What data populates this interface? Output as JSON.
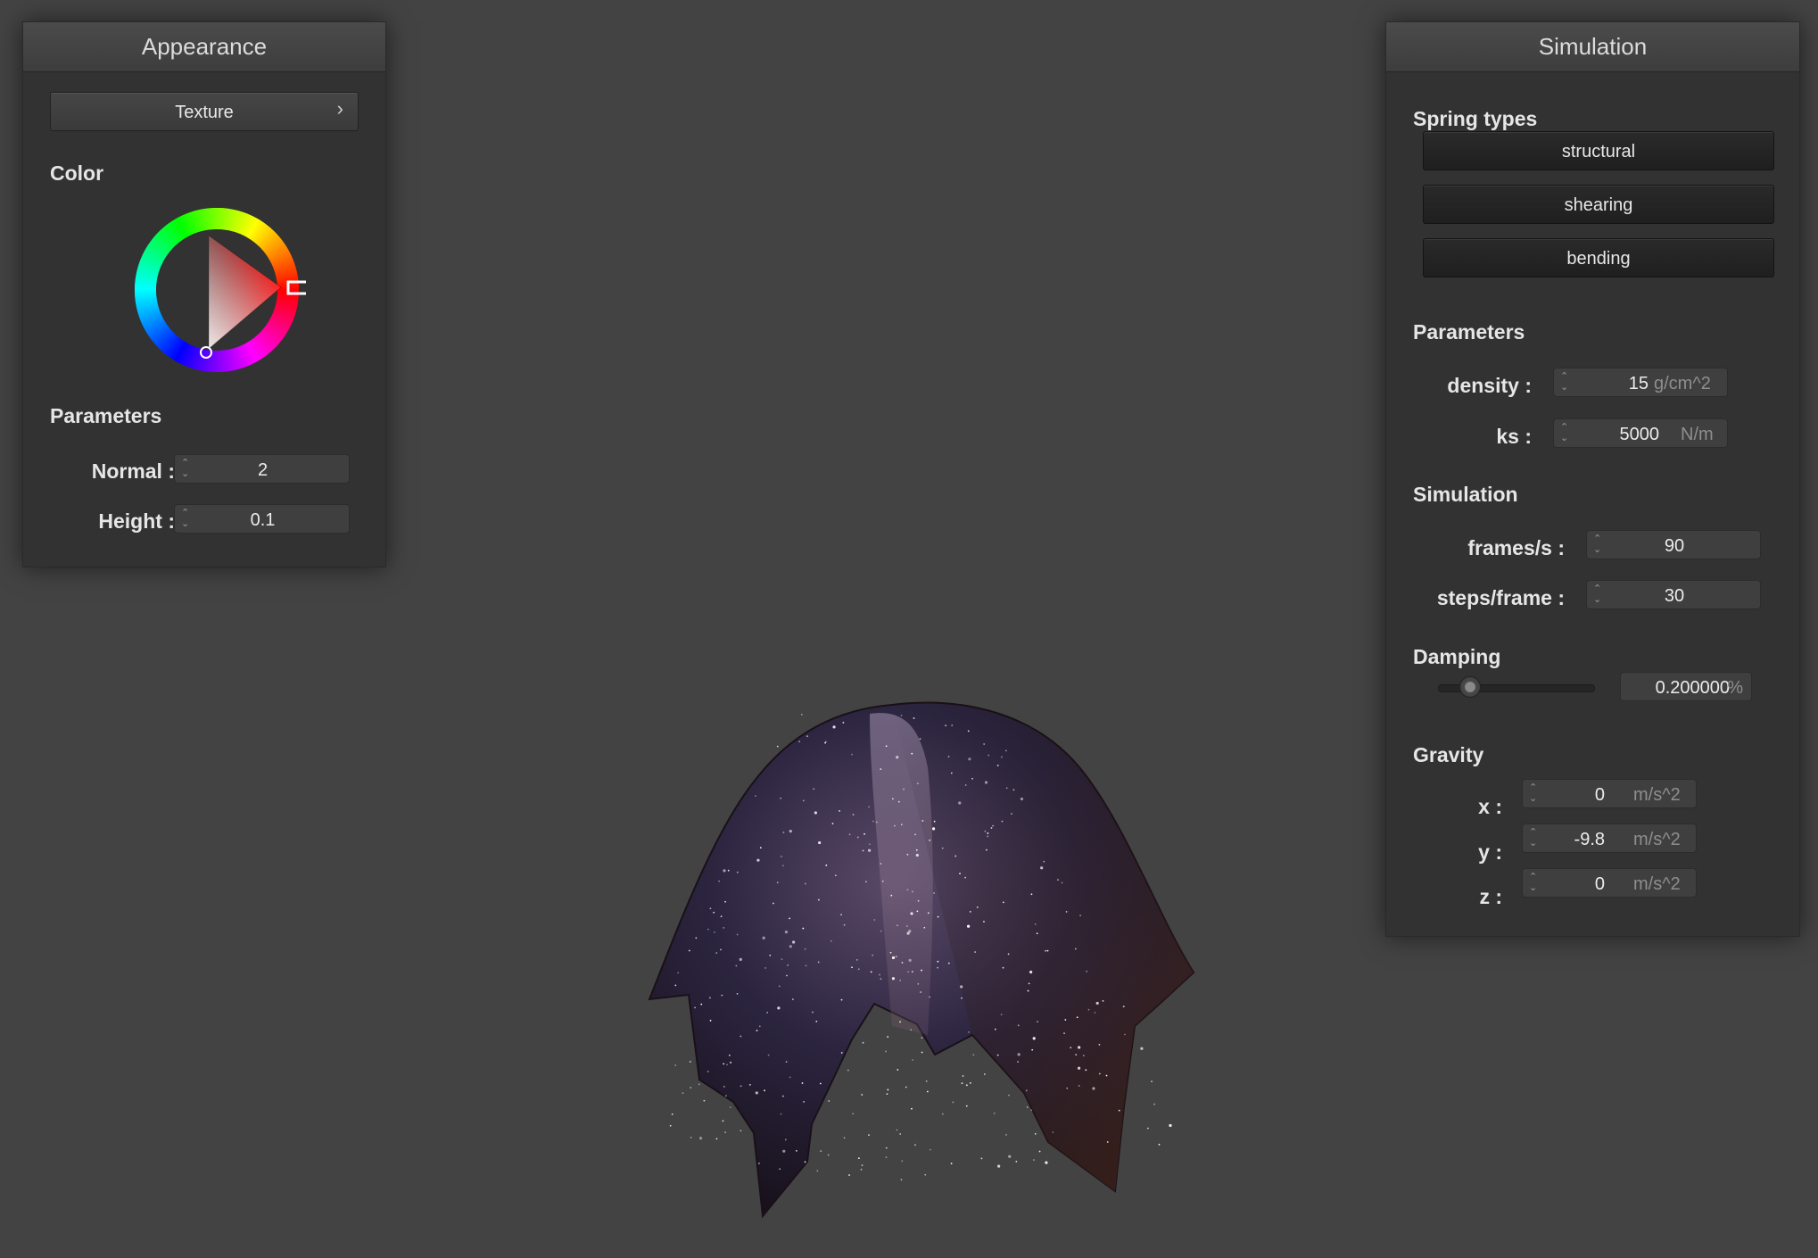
{
  "appearance": {
    "title": "Appearance",
    "texture_button": "Texture",
    "texture_chevron": "›",
    "color_label": "Color",
    "color_value": "#ff0000",
    "parameters_label": "Parameters",
    "normal": {
      "label": "Normal :",
      "value": "2"
    },
    "height": {
      "label": "Height :",
      "value": "0.1"
    }
  },
  "simulation": {
    "title": "Simulation",
    "spring_types_label": "Spring types",
    "spring_types": [
      "structural",
      "shearing",
      "bending"
    ],
    "parameters_label": "Parameters",
    "density": {
      "label": "density :",
      "value": "15",
      "unit": "g/cm^2"
    },
    "ks": {
      "label": "ks :",
      "value": "5000",
      "unit": "N/m"
    },
    "simulation_label": "Simulation",
    "frames_per_s": {
      "label": "frames/s :",
      "value": "90"
    },
    "steps_per_frame": {
      "label": "steps/frame :",
      "value": "30"
    },
    "damping_label": "Damping",
    "damping": {
      "value": "0.200000",
      "unit": "%",
      "slider_fraction": 0.2
    },
    "gravity_label": "Gravity",
    "gravity": {
      "x": {
        "label": "x :",
        "value": "0",
        "unit": "m/s^2"
      },
      "y": {
        "label": "y :",
        "value": "-9.8",
        "unit": "m/s^2"
      },
      "z": {
        "label": "z :",
        "value": "0",
        "unit": "m/s^2"
      }
    }
  },
  "spinner_glyph": "⌃⌄",
  "icons": {
    "spinner": "spinner-arrows-icon",
    "chevron": "chevron-right-icon",
    "cloth": "cloth-mesh"
  }
}
